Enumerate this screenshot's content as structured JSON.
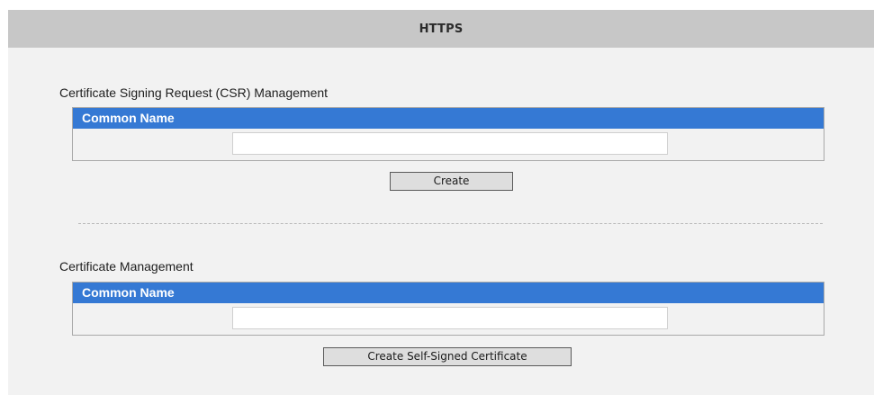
{
  "page": {
    "title": "HTTPS"
  },
  "csr": {
    "heading": "Certificate Signing Request (CSR) Management",
    "table_header": "Common Name",
    "common_name_value": "",
    "button_label": "Create"
  },
  "cert": {
    "heading": "Certificate Management",
    "table_header": "Common Name",
    "common_name_value": "",
    "button_label": "Create Self-Signed Certificate"
  },
  "colors": {
    "header_blue": "#3579d4",
    "title_bar_gray": "#c7c7c7",
    "page_background": "#f2f2f2"
  }
}
